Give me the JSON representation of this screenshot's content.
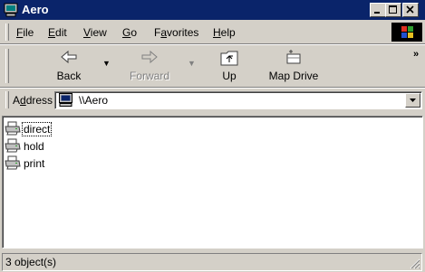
{
  "window": {
    "title": "Aero"
  },
  "menu": {
    "items": [
      {
        "label": "File",
        "key": "F",
        "rest": "ile"
      },
      {
        "label": "Edit",
        "key": "E",
        "rest": "dit"
      },
      {
        "label": "View",
        "key": "V",
        "rest": "iew"
      },
      {
        "label": "Go",
        "key": "G",
        "rest": "o"
      },
      {
        "label": "Favorites",
        "pre": "F",
        "key": "a",
        "rest": "vorites"
      },
      {
        "label": "Help",
        "key": "H",
        "rest": "elp"
      }
    ]
  },
  "toolbar": {
    "back_label": "Back",
    "forward_label": "Forward",
    "up_label": "Up",
    "map_drive_label": "Map Drive",
    "more_glyph": "»"
  },
  "address": {
    "label_pre": "A",
    "label_key": "d",
    "label_rest": "dress",
    "value": "\\\\Aero"
  },
  "content": {
    "items": [
      {
        "label": "direct",
        "icon": "printer-icon",
        "focused": true
      },
      {
        "label": "hold",
        "icon": "printer-icon",
        "focused": false
      },
      {
        "label": "print",
        "icon": "printer-icon",
        "focused": false
      }
    ]
  },
  "status": {
    "text": "3 object(s)"
  },
  "colors": {
    "titlebar": "#0a246a",
    "chrome": "#d4d0c8",
    "window": "#ffffff"
  }
}
